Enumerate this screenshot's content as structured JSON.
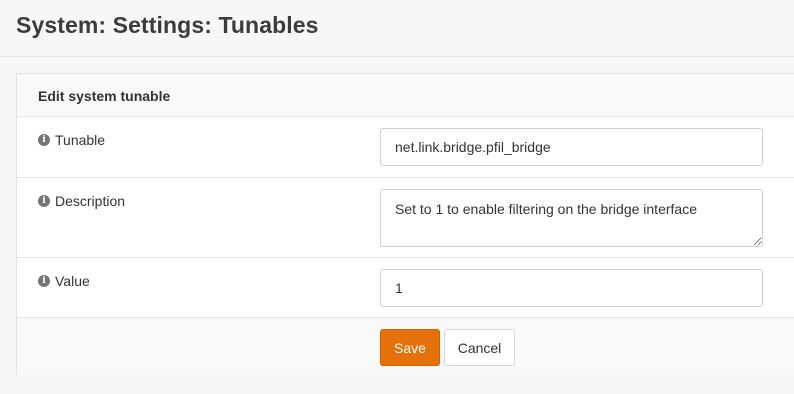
{
  "page": {
    "title": "System: Settings: Tunables"
  },
  "panel": {
    "heading": "Edit system tunable"
  },
  "fields": {
    "tunable": {
      "label": "Tunable",
      "value": "net.link.bridge.pfil_bridge",
      "icon": "info-icon"
    },
    "description": {
      "label": "Description",
      "value": "Set to 1 to enable filtering on the bridge interface",
      "icon": "info-icon"
    },
    "value": {
      "label": "Value",
      "value": "1",
      "icon": "info-icon"
    }
  },
  "actions": {
    "save_label": "Save",
    "cancel_label": "Cancel"
  },
  "colors": {
    "accent": "#e6700a"
  }
}
